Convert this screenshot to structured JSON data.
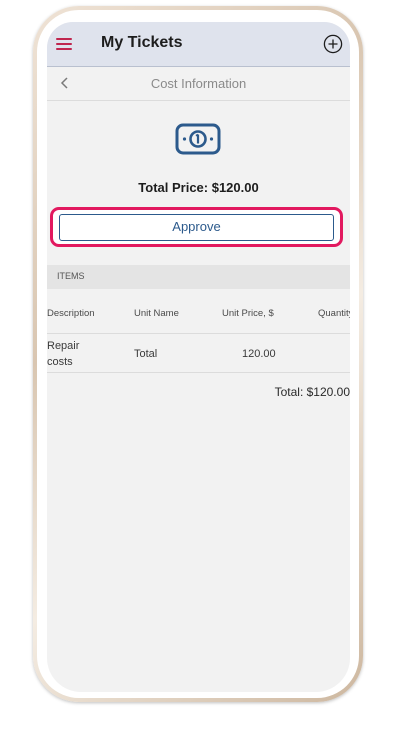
{
  "header": {
    "title": "My Tickets"
  },
  "subheader": {
    "title": "Cost Information"
  },
  "summary": {
    "total_price": "Total Price: $120.00"
  },
  "actions": {
    "approve_label": "Approve"
  },
  "items": {
    "section_label": "ITEMS",
    "columns": [
      "Description",
      "Unit Name",
      "Unit Price, $",
      "Quantity"
    ],
    "rows": [
      {
        "description_line1": "Repair",
        "description_line2": "costs",
        "unit_name": "Total",
        "unit_price": "120.00",
        "quantity": ""
      }
    ],
    "total": "Total: $120.00"
  },
  "icons": {
    "menu": "hamburger-icon",
    "add": "plus-circle-icon",
    "back": "chevron-left-icon",
    "money": "money-bill-icon"
  },
  "colors": {
    "accent": "#c0264f",
    "highlight": "#e2195f",
    "primary_blue": "#2c5a8c",
    "header_bg": "#dfe3ed",
    "screen_bg": "#f2f2f2"
  }
}
